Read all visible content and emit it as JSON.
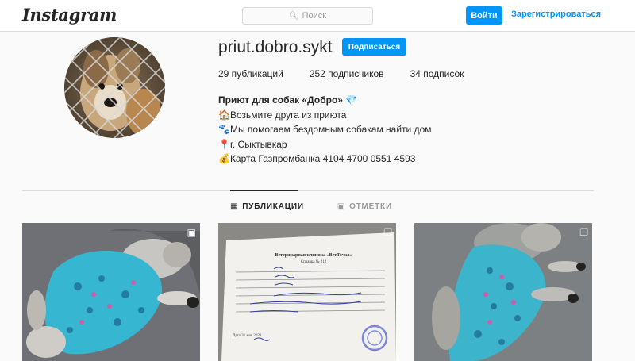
{
  "header": {
    "logo": "Instagram",
    "search_placeholder": "Поиск",
    "login_label": "Войти",
    "register_label": "Зарегистрироваться"
  },
  "profile": {
    "username": "priut.dobro.sykt",
    "follow_label": "Подписаться",
    "stats": {
      "posts": "29 публикаций",
      "followers": "252 подписчиков",
      "following": "34 подписок"
    },
    "bio": {
      "name": "Приют для собак «Добро» 💎",
      "line1": "🏠Возьмите друга из приюта",
      "line2": "🐾Мы помогаем бездомным собакам найти дом",
      "line3": "📍г. Сыктывкар",
      "line4": "💰Карта Газпромбанка 4104 4700 0551 4593"
    }
  },
  "tabs": {
    "posts": "ПУБЛИКАЦИИ",
    "tagged": "ОТМЕТКИ"
  },
  "posts": [
    {
      "type": "video",
      "icon": "video-icon"
    },
    {
      "type": "carousel",
      "icon": "carousel-icon",
      "doc_title": "Ветеринарная клиника «ВетТочка»",
      "doc_subtitle": "Справка № 212",
      "doc_date": "Дата 31 мая 2021"
    },
    {
      "type": "carousel",
      "icon": "carousel-icon"
    }
  ],
  "colors": {
    "accent": "#0095f6",
    "border": "#dbdbdb",
    "background": "#fafafa"
  }
}
